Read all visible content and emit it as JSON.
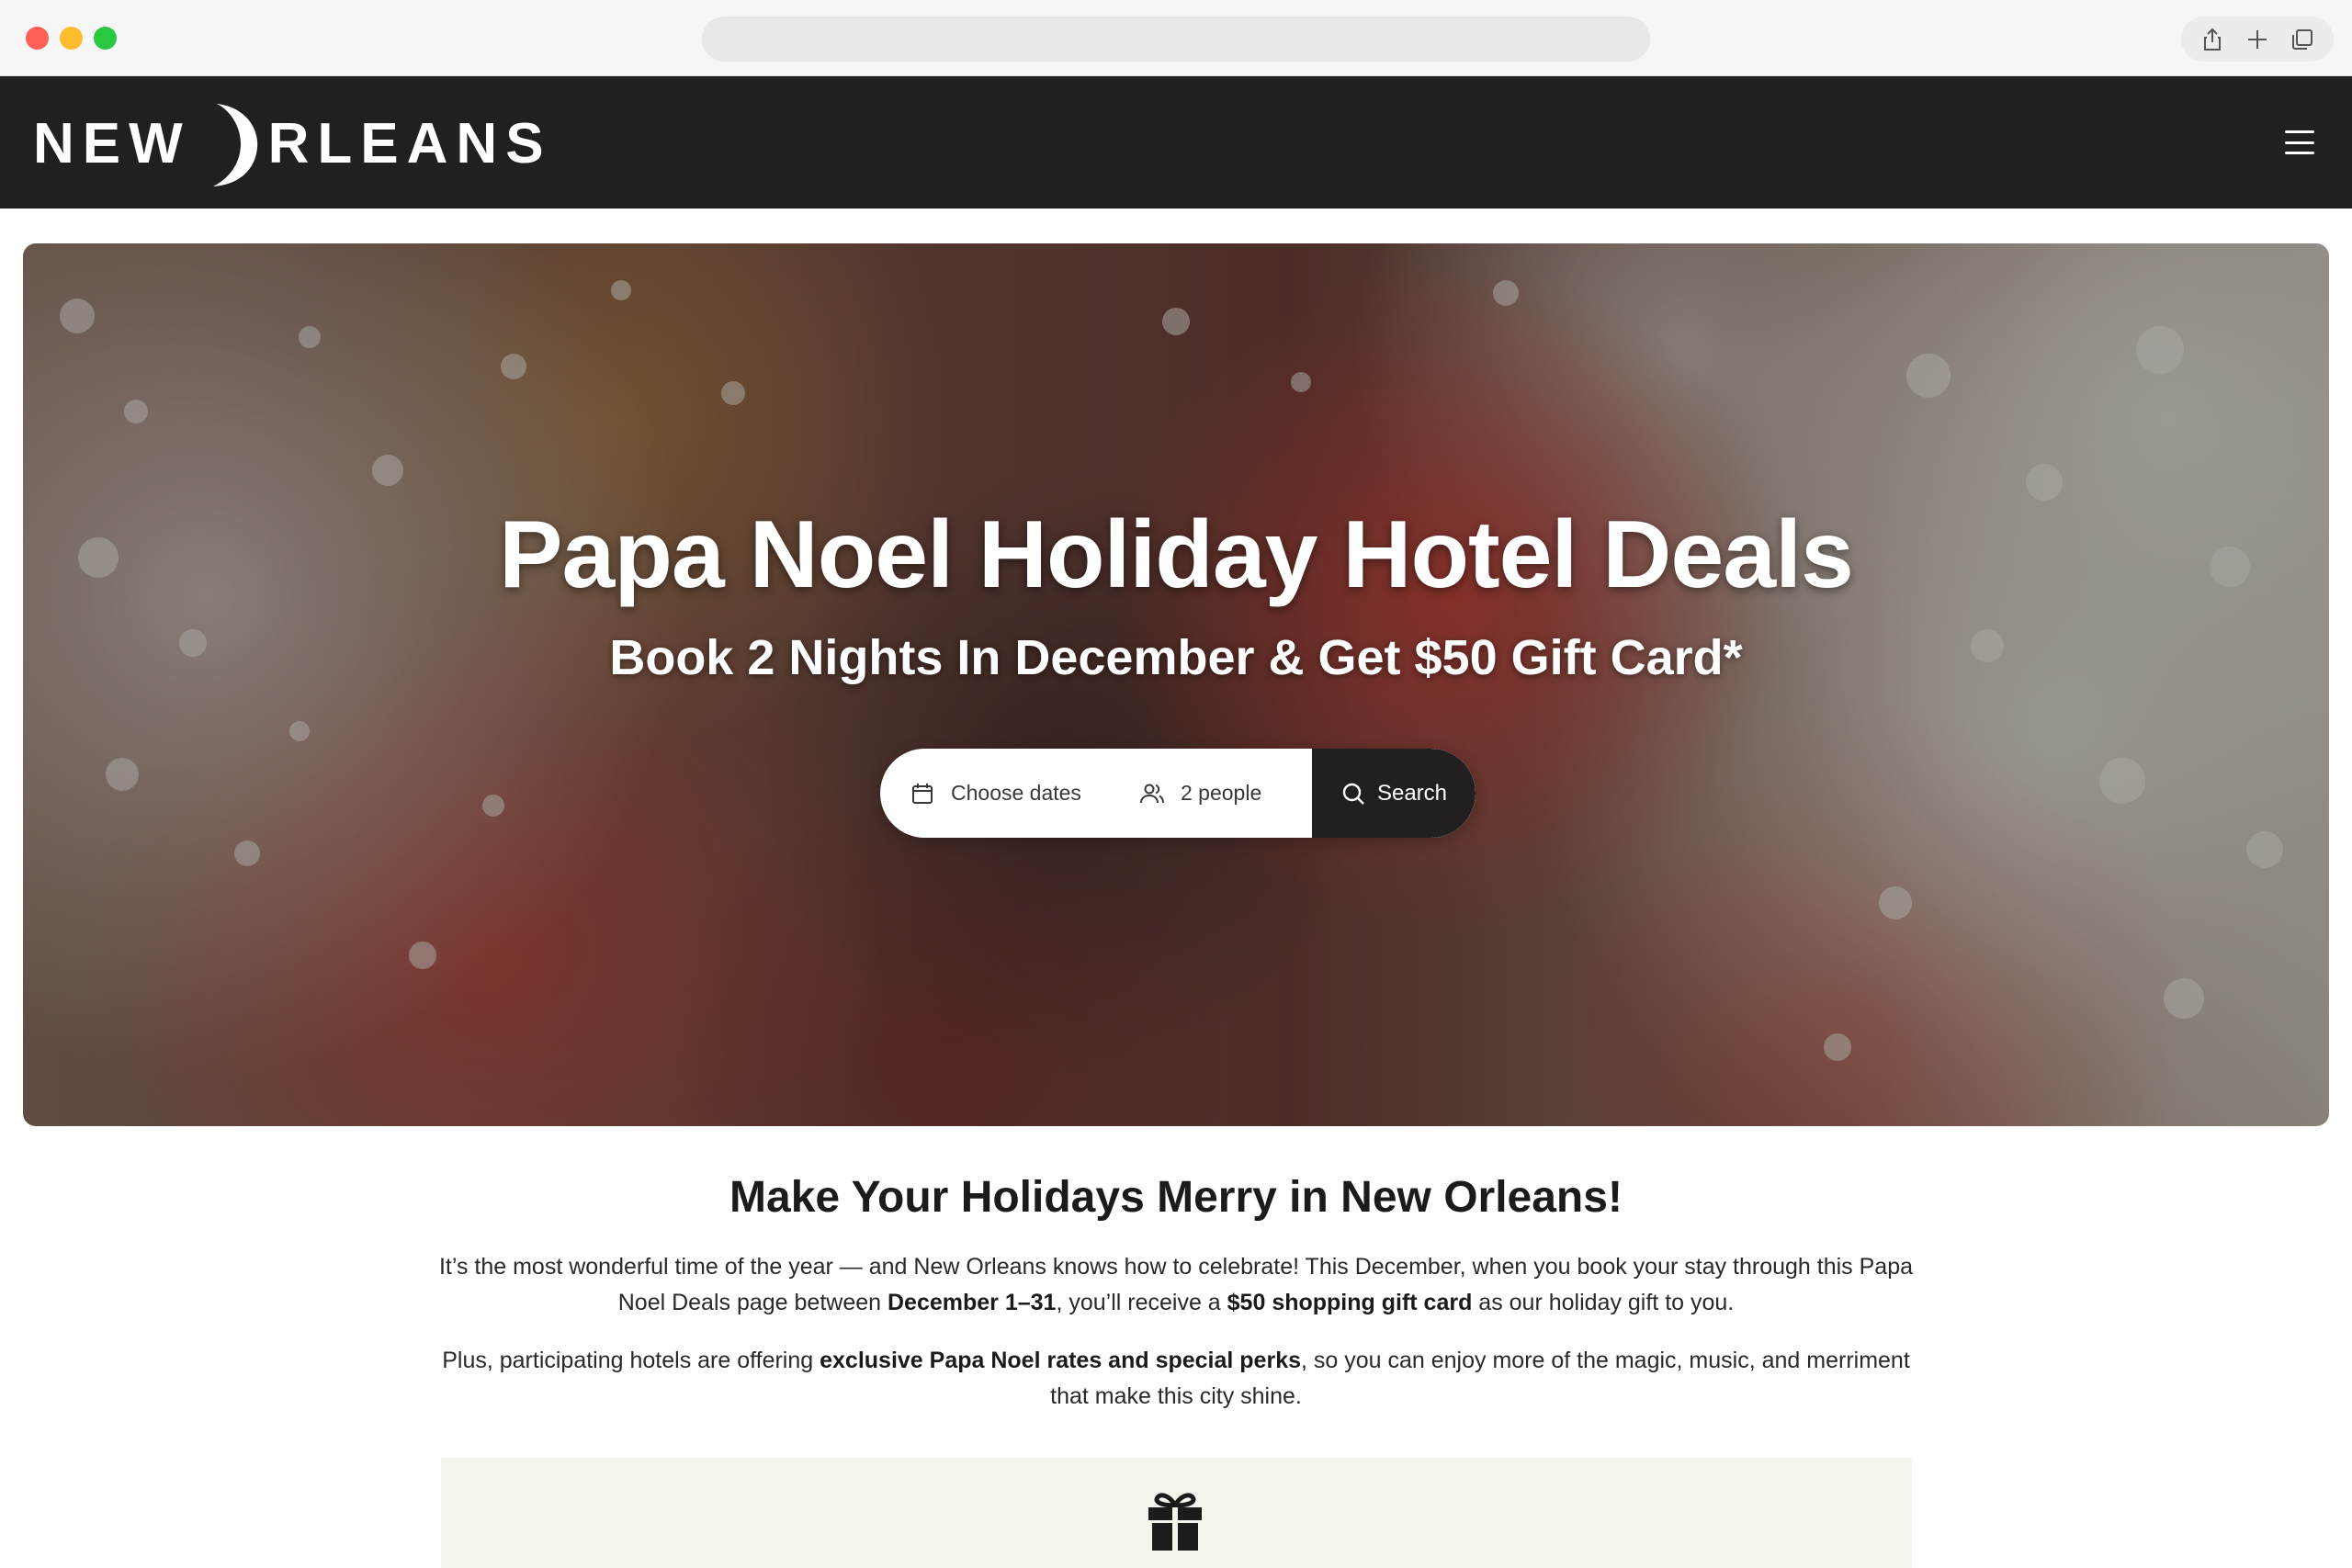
{
  "browser": {
    "url": "",
    "buttons": [
      "share-icon",
      "new-tab-icon",
      "tabs-overview-icon"
    ]
  },
  "header": {
    "logo_left": "NEW",
    "logo_right": "RLEANS",
    "menu_icon": "hamburger-menu-icon",
    "background_color": "#221f20"
  },
  "hero": {
    "title": "Papa Noel Holiday Hotel Deals",
    "subtitle": "Book 2 Nights In December & Get $50 Gift Card*",
    "search": {
      "dates_label": "Choose dates",
      "dates_icon": "calendar-icon",
      "people_label": "2 people",
      "people_icon": "people-icon",
      "search_label": "Search",
      "search_icon": "search-icon"
    }
  },
  "content": {
    "heading": "Make Your Holidays Merry in New Orleans!",
    "para1": {
      "part1": "It’s the most wonderful time of the year — and New Orleans knows how to celebrate! This December, when you book your stay through this Papa Noel Deals page between ",
      "bold1": "December 1–31",
      "part2": ", you’ll receive a ",
      "bold2": "$50 shopping gift card",
      "part3": " as our holiday gift to you."
    },
    "para2": {
      "part1": "Plus, participating hotels are offering ",
      "bold1": "exclusive Papa Noel rates and special perks",
      "part2": ", so you can enjoy more of the magic, music, and merriment that make this city shine."
    },
    "perk_icon": "gift-icon",
    "perk_box_color": "#f4f3ec"
  }
}
